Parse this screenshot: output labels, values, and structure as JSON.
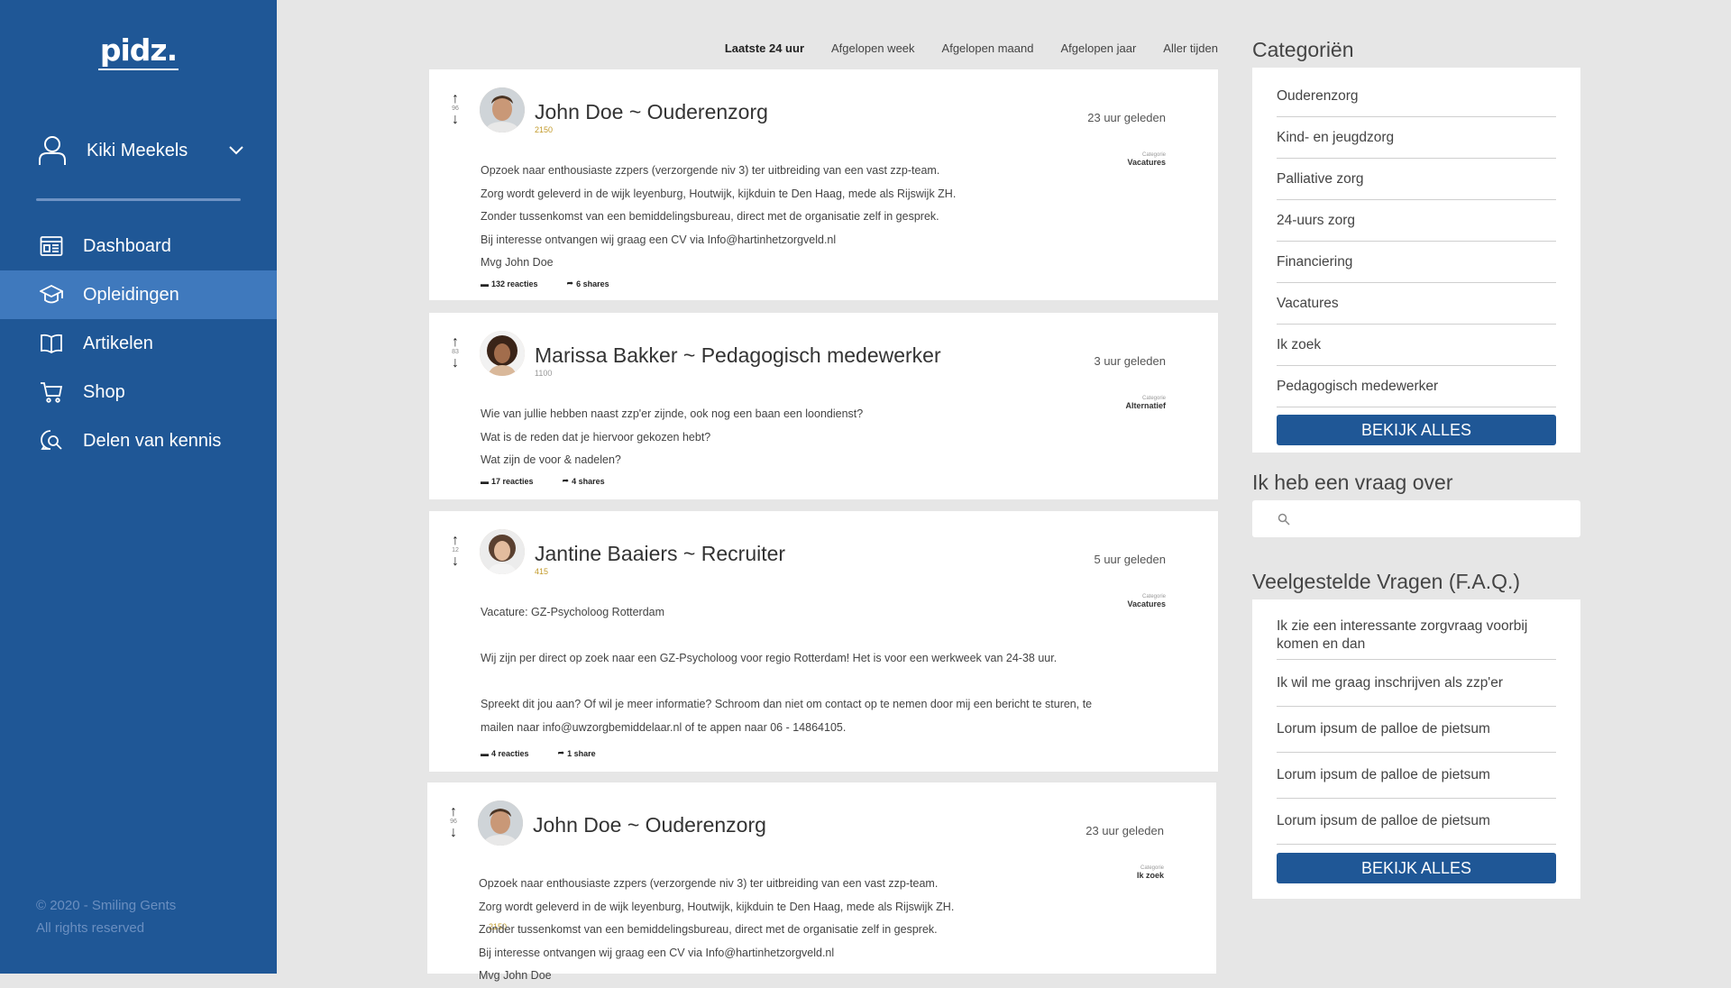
{
  "sidebar": {
    "logo": "pidz.",
    "user_name": "Kiki Meekels",
    "nav": [
      {
        "label": "Dashboard",
        "icon": "dashboard-icon"
      },
      {
        "label": "Opleidingen",
        "icon": "graduation-cap-icon",
        "active": true
      },
      {
        "label": "Artikelen",
        "icon": "book-icon"
      },
      {
        "label": "Shop",
        "icon": "cart-icon"
      },
      {
        "label": "Delen van kennis",
        "icon": "chat-search-icon"
      }
    ],
    "footer_line1": "© 2020 - Smiling Gents",
    "footer_line2": "All rights reserved"
  },
  "filters": {
    "active": "Laatste 24 uur",
    "week": "Afgelopen week",
    "month": "Afgelopen maand",
    "year": "Afgelopen jaar",
    "all": "Aller tijden"
  },
  "posts": [
    {
      "votes": "96",
      "title": "John Doe ~ Ouderenzorg",
      "score": "2150",
      "time": "23 uur geleden",
      "category_label": "Categorie",
      "category": "Vacatures",
      "lines": [
        "Opzoek naar enthousiaste zzpers (verzorgende niv 3) ter uitbreiding van een vast zzp-team.",
        "Zorg wordt geleverd in de wijk leyenburg, Houtwijk, kijkduin  te Den Haag, mede als Rijswijk ZH.",
        "Zonder tussenkomst van een bemiddelingsbureau, direct met de organisatie zelf in gesprek.",
        "Bij interesse ontvangen wij graag een CV via Info@hartinhetzorgveld.nl",
        "Mvg John Doe"
      ],
      "reactions": "132 reacties",
      "shares": "6 shares"
    },
    {
      "votes": "83",
      "title": "Marissa Bakker ~ Pedagogisch medewerker",
      "score": "1100",
      "time": "3 uur geleden",
      "category_label": "Categorie",
      "category": "Alternatief",
      "lines": [
        "Wie van jullie hebben naast zzp'er zijnde, ook nog een baan een loondienst?",
        "Wat is de reden dat je hiervoor gekozen hebt?",
        "Wat zijn de voor & nadelen?"
      ],
      "reactions": "17 reacties",
      "shares": "4 shares"
    },
    {
      "votes": "12",
      "title": "Jantine Baaiers ~ Recruiter",
      "score": "415",
      "time": "5 uur geleden",
      "category_label": "Categorie",
      "category": "Vacatures",
      "lines": [
        "Vacature: GZ-Psycholoog Rotterdam",
        "",
        "Wij zijn per direct op zoek naar een GZ-Psycholoog voor regio Rotterdam! Het is voor een werkweek van 24-38 uur.",
        "",
        "Spreekt dit jou aan? Of wil je meer informatie? Schroom dan niet om contact op te nemen door mij een bericht te sturen, te",
        "mailen naar info@uwzorgbemiddelaar.nl of te appen naar 06 - 14864105."
      ],
      "reactions": "4 reacties",
      "shares": "1 share"
    },
    {
      "votes": "96",
      "title": "John Doe ~ Ouderenzorg",
      "score": "2150",
      "time": "23 uur geleden",
      "category_label": "Categorie",
      "category": "Ik zoek",
      "lines": [
        "Opzoek naar enthousiaste zzpers (verzorgende niv 3) ter uitbreiding van een vast zzp-team.",
        "Zorg wordt geleverd in de wijk leyenburg, Houtwijk, kijkduin  te Den Haag, mede als Rijswijk ZH.",
        "Zonder tussenkomst van een bemiddelingsbureau, direct met de organisatie zelf in gesprek.",
        "Bij interesse ontvangen wij graag een CV via Info@hartinhetzorgveld.nl",
        "Mvg John Doe"
      ]
    }
  ],
  "categories": {
    "title": "Categoriën",
    "items": [
      "Ouderenzorg",
      "Kind- en jeugdzorg",
      "Palliative zorg",
      "24-uurs zorg",
      "Financiering",
      "Vacatures",
      "Ik zoek",
      "Pedagogisch medewerker"
    ],
    "button": "BEKIJK ALLES"
  },
  "question": {
    "title": "Ik heb een vraag over",
    "placeholder": ""
  },
  "faq": {
    "title": "Veelgestelde Vragen (F.A.Q.)",
    "items": [
      "Ik zie een interessante zorgvraag voorbij komen en dan",
      "Ik wil me graag inschrijven als zzp'er",
      "Lorum ipsum de palloe de pietsum",
      "Lorum ipsum de palloe de pietsum",
      "Lorum ipsum de palloe de pietsum"
    ],
    "button": "BEKIJK ALLES"
  },
  "colors": {
    "sidebar": "#1f5796",
    "active_nav": "#3f79bd",
    "button": "#1f5796",
    "score": "#c29a2b"
  }
}
